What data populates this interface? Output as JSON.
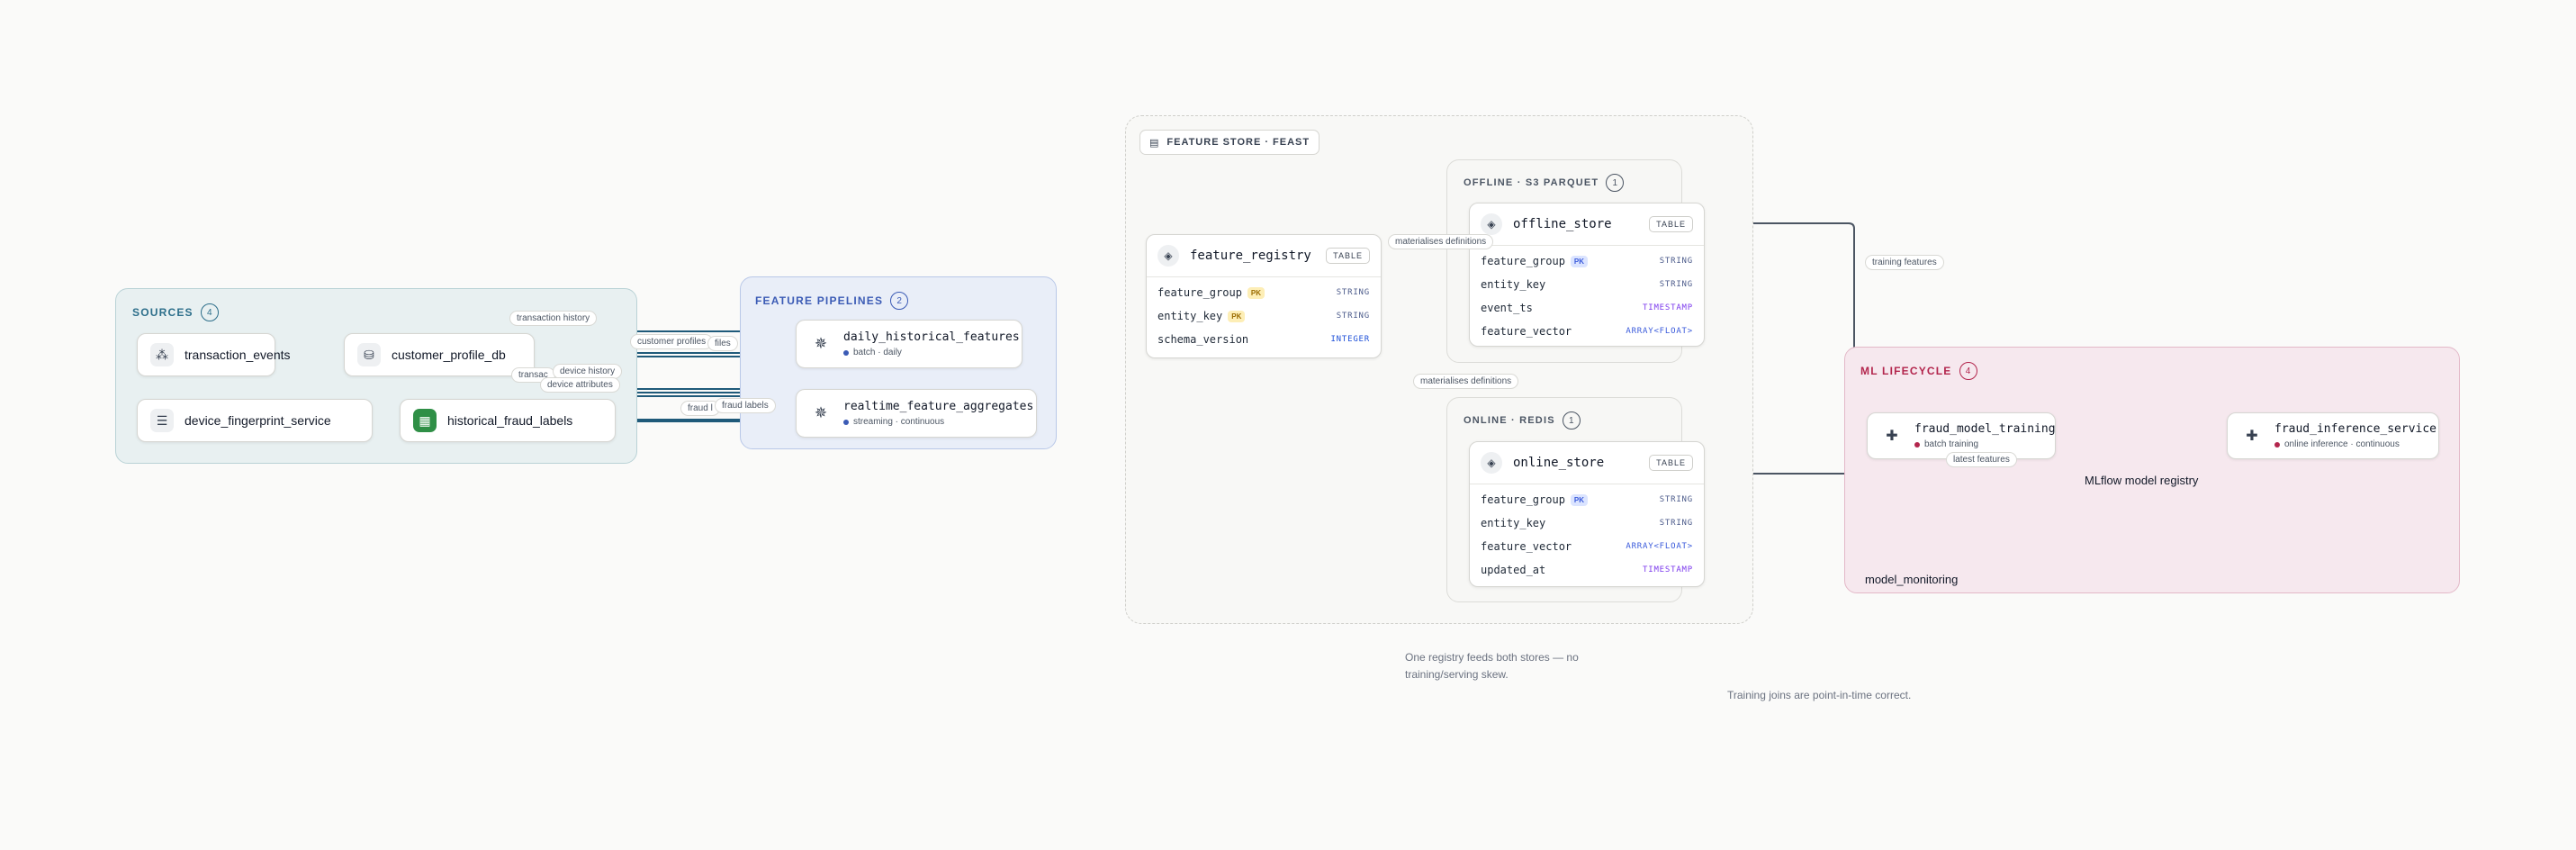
{
  "colors": {
    "sources": "#2c6e8a",
    "pipelines": "#3b5bb5",
    "ml": "#b3264d",
    "edge": "#4b5563",
    "source_edge": "#1f5a7a",
    "pk_bg": "#fdeeb6",
    "pk_fg": "#9a6b00",
    "pk_blue_bg": "#dbe4ff",
    "pk_blue_fg": "#3b5bdb",
    "type_string": "#4b5a8a",
    "type_integer": "#1d4fd8",
    "type_timestamp": "#7c3aed"
  },
  "sources": {
    "title": "SOURCES",
    "count": "4",
    "nodes": [
      {
        "label": "transaction_events",
        "icon": "kafka-icon"
      },
      {
        "label": "customer_profile_db",
        "icon": "database-user-icon"
      },
      {
        "label": "device_fingerprint_service",
        "icon": "server-icon"
      },
      {
        "label": "historical_fraud_labels",
        "icon": "spreadsheet-icon"
      }
    ]
  },
  "pipelines": {
    "title": "FEATURE PIPELINES",
    "count": "2",
    "nodes": [
      {
        "label": "daily_historical_features",
        "sub": "batch · daily",
        "dot": "#3b5bb5"
      },
      {
        "label": "realtime_feature_aggregates",
        "sub": "streaming · continuous",
        "dot": "#3b5bb5"
      }
    ]
  },
  "feature_store": {
    "title": "FEATURE STORE · FEAST",
    "registry": {
      "label": "feature_registry",
      "tag": "TABLE",
      "fields": [
        {
          "name": "feature_group",
          "pk": "PK",
          "type": "STRING"
        },
        {
          "name": "entity_key",
          "pk": "PK",
          "type": "STRING"
        },
        {
          "name": "schema_version",
          "pk": "",
          "type": "INTEGER"
        }
      ]
    },
    "offline": {
      "title": "OFFLINE · S3 PARQUET",
      "count": "1",
      "label": "offline_store",
      "tag": "TABLE",
      "fields": [
        {
          "name": "feature_group",
          "pk": "PK",
          "type": "STRING"
        },
        {
          "name": "entity_key",
          "pk": "",
          "type": "STRING"
        },
        {
          "name": "event_ts",
          "pk": "",
          "type": "TIMESTAMP"
        },
        {
          "name": "feature_vector",
          "pk": "",
          "type": "ARRAY<FLOAT>"
        }
      ]
    },
    "online": {
      "title": "ONLINE · REDIS",
      "count": "1",
      "label": "online_store",
      "tag": "TABLE",
      "fields": [
        {
          "name": "feature_group",
          "pk": "PK",
          "type": "STRING"
        },
        {
          "name": "entity_key",
          "pk": "",
          "type": "STRING"
        },
        {
          "name": "feature_vector",
          "pk": "",
          "type": "ARRAY<FLOAT>"
        },
        {
          "name": "updated_at",
          "pk": "",
          "type": "TIMESTAMP"
        }
      ]
    }
  },
  "ml": {
    "title": "ML LIFECYCLE",
    "count": "4",
    "training": {
      "label": "fraud_model_training",
      "sub": "batch training",
      "dot": "#b3264d"
    },
    "inference": {
      "label": "fraud_inference_service",
      "sub": "online inference · continuous",
      "dot": "#b3264d"
    },
    "registry_label": "MLflow model registry",
    "monitoring_label": "model_monitoring"
  },
  "edge_labels": {
    "transaction_history": "transaction history",
    "customer_profiles": "customer profiles",
    "files": "files",
    "transac": "transac",
    "device_history": "device history",
    "device_attributes": "device attributes",
    "fraud_l": "fraud l",
    "fraud_labels": "fraud labels",
    "materialises_1": "materialises definitions",
    "materialises_2": "materialises definitions",
    "training_features": "training features",
    "latest_features": "latest features"
  },
  "notes": {
    "skew": "One registry feeds both stores — no training/serving skew.",
    "pit": "Training joins are point-in-time correct."
  }
}
